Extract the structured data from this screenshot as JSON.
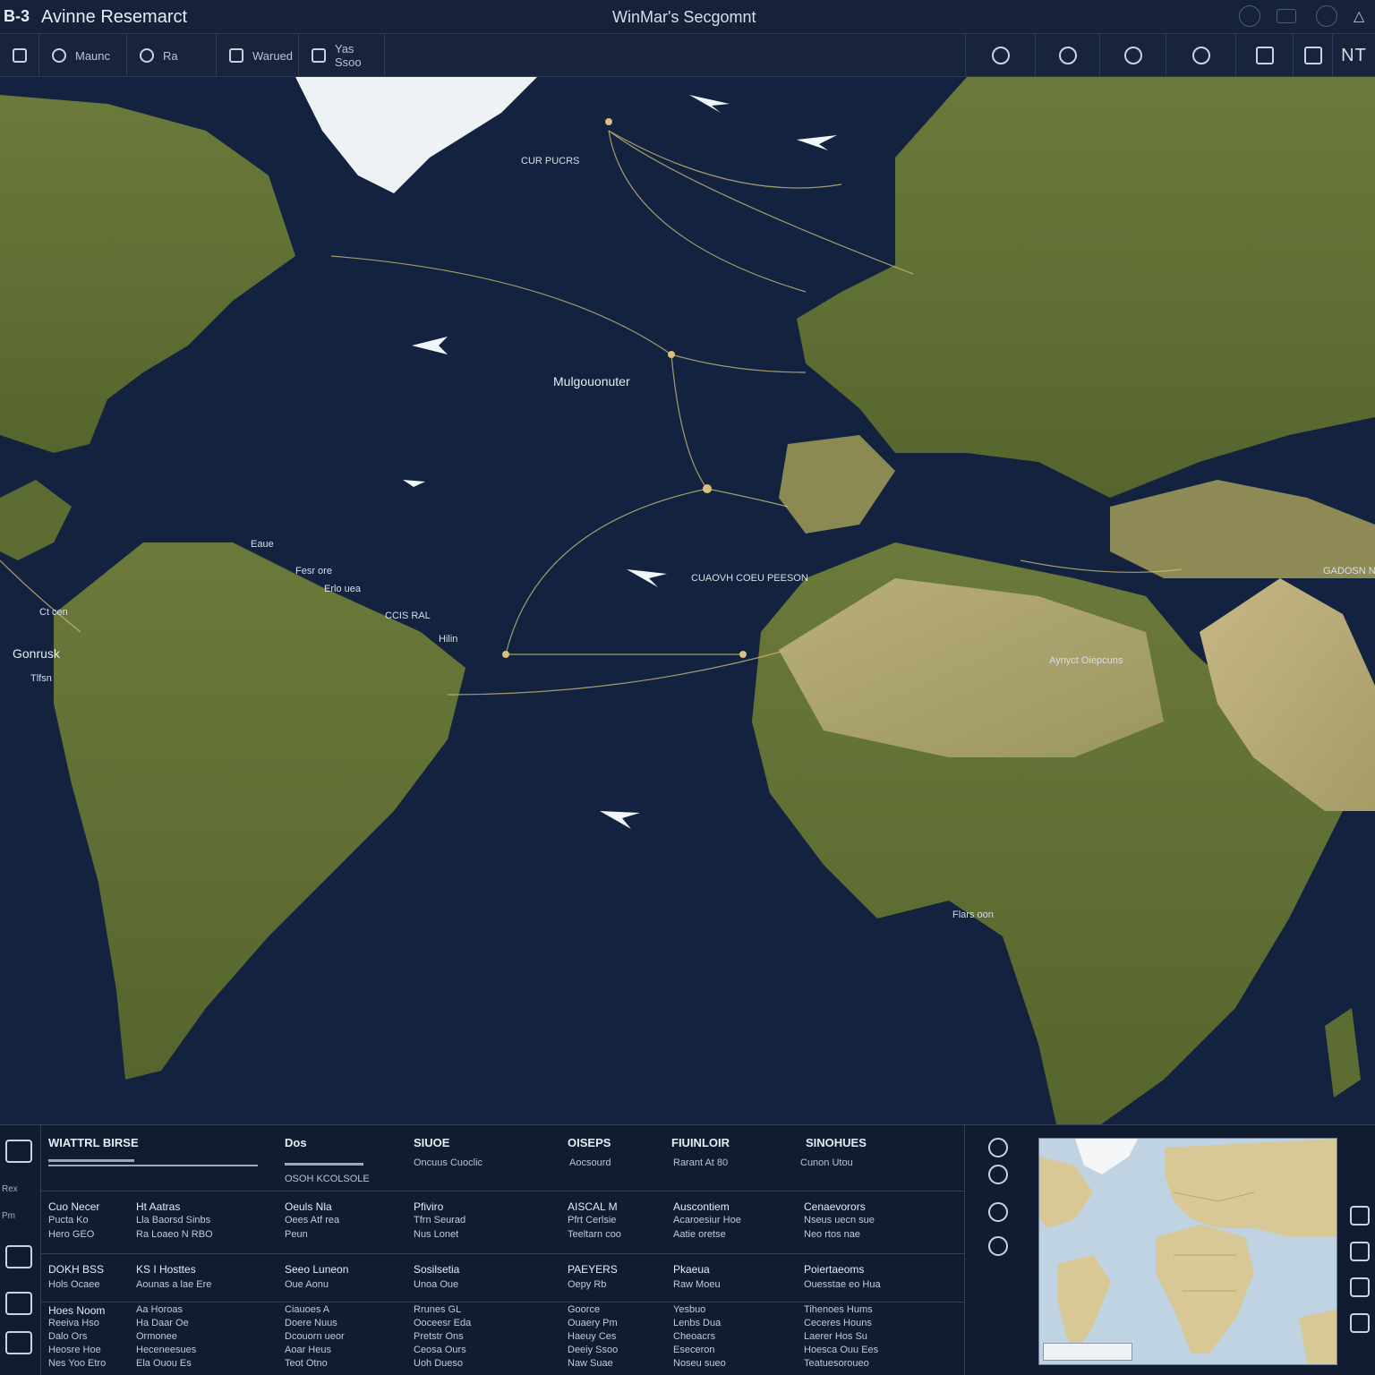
{
  "titlebar": {
    "badge": "B-3",
    "app_title": "Avinne Resemarct",
    "window_title": "WinMar's Secgomnt"
  },
  "toolbar": {
    "items": [
      {
        "label": "",
        "icon": "chevron-icon"
      },
      {
        "label": "Maunc",
        "icon": "route-icon"
      },
      {
        "label": "Ra",
        "icon": "flight-icon"
      },
      {
        "label": "Warued",
        "icon": "folder-icon"
      },
      {
        "label": "Yas Ssoo",
        "icon": "layers-icon"
      }
    ],
    "right_text": "NT"
  },
  "map": {
    "labels": [
      {
        "text": "CUR PUCRS",
        "name": "label-north-atlantic"
      },
      {
        "text": "Mulgouonuter",
        "name": "label-mid-atlantic"
      },
      {
        "text": "CUAOVH COEU PEESON",
        "name": "label-canary"
      },
      {
        "text": "Gonrusk",
        "name": "label-west-sa"
      },
      {
        "text": "Tlfsn",
        "name": "label-west-sa-sub"
      },
      {
        "text": "Aynyct Oiepcuns",
        "name": "label-sahara"
      },
      {
        "text": "GADOSN NUEIE",
        "name": "label-arabia"
      },
      {
        "text": "Fesr ore",
        "name": "label-brazil-a"
      },
      {
        "text": "Erlo uea",
        "name": "label-brazil-b"
      },
      {
        "text": "CCIS RAL",
        "name": "label-caribbean"
      },
      {
        "text": "Hilin",
        "name": "label-caribbean-b"
      },
      {
        "text": "Eaue",
        "name": "label-guyana"
      },
      {
        "text": "Ct cen",
        "name": "label-amazon"
      },
      {
        "text": "Flars oon",
        "name": "label-atlantic-south"
      }
    ]
  },
  "panel": {
    "columns": [
      {
        "header": "WIATTRL BIRSE",
        "sub": ""
      },
      {
        "header": "Dos",
        "sub": "OSOH KCOLSOLE"
      },
      {
        "header": "SIUOE",
        "sub": "Oncuus Cuoclic"
      },
      {
        "header": "OISEPS",
        "sub": "Aocsourd"
      },
      {
        "header": "FIUINLOIR",
        "sub": "Rarant At 80"
      },
      {
        "header": "SINOHUES",
        "sub": "Cunon Utou"
      }
    ],
    "rows_group1": [
      [
        "Cuo Necer",
        "Ht Aatras",
        "Oeuls Nla",
        "Pfiviro",
        "AISCAL M",
        "Auscontiem",
        "Cenaevorors"
      ],
      [
        "Pucta Ko",
        "Lla Baorsd Sinbs",
        "Oees Atf rea",
        "Tfrn Seurad",
        "Pfrt Cerlsie",
        "Acaroesiur Hoe",
        "Nseus uecn sue"
      ],
      [
        "Hero GEO",
        "Ra Loaeo N RBO",
        "Peun",
        "Nus Lonet",
        "Teeltarn coo",
        "Aatie oretse",
        "Neo rtos nae"
      ]
    ],
    "rows_group2": [
      [
        "DOKH BSS",
        "KS I Hosttes",
        "Seeo Luneon",
        "Sosilsetia",
        "PAEYERS",
        "Pkaeua",
        "Poiertaeoms"
      ],
      [
        "Hols Ocaee",
        "Aounas a lae Ere",
        "Oue Aonu",
        "Unoa Oue",
        "Oepy Rb",
        "Raw Moeu",
        "Ouesstae eo Hua"
      ]
    ],
    "rows_group3": [
      [
        "Hoes Noom",
        "Aa Horoas",
        "Ciauoes A",
        "Rrunes GL",
        "Goorce",
        "Yesbuo",
        "Tihenoes Hums"
      ],
      [
        "Reeiva Hso",
        "Ha Daar Oe",
        "Doere Nuus",
        "Ooceesr Eda",
        "Ouaery Pm",
        "Lenbs Dua",
        "Ceceres Houns"
      ],
      [
        "Dalo Ors",
        "Ormonee",
        "Dcouorn ueor",
        "Pretstr Ons",
        "Haeuy Ces",
        "Cheoacrs",
        "Laerer Hos Su"
      ],
      [
        "Heosre Hoe",
        "Heceneesues",
        "Aoar Heus",
        "Ceosa Ours",
        "Deeiy Ssoo",
        "Eseceron",
        "Hoesca Ouu Ees"
      ],
      [
        "Nes Yoo Etro",
        "Ela Ouou Es",
        "Teot Otno",
        "Uoh Dueso",
        "Naw Suae",
        "Noseu sueo",
        "Teatuesoroueo"
      ]
    ],
    "side_tools": [
      "Rex",
      "Pm"
    ],
    "minimap_badge": ""
  }
}
